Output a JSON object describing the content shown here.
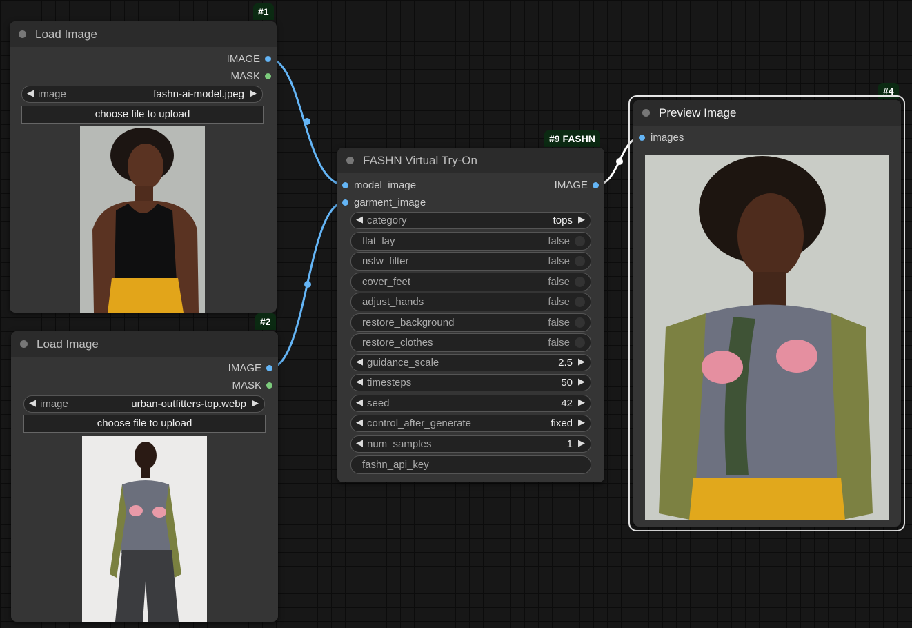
{
  "load1": {
    "badge": "#1",
    "title": "Load Image",
    "out_image": "IMAGE",
    "out_mask": "MASK",
    "combo_label": "image",
    "combo_value": "fashn-ai-model.jpeg",
    "upload_label": "choose file to upload"
  },
  "load2": {
    "badge": "#2",
    "title": "Load Image",
    "out_image": "IMAGE",
    "out_mask": "MASK",
    "combo_label": "image",
    "combo_value": "urban-outfitters-top.webp",
    "upload_label": "choose file to upload"
  },
  "fashn": {
    "badge": "#9 FASHN",
    "title": "FASHN Virtual Try-On",
    "in_model": "model_image",
    "in_garment": "garment_image",
    "out_image": "IMAGE",
    "widgets": [
      {
        "label": "category",
        "value": "tops",
        "kind": "combo"
      },
      {
        "label": "flat_lay",
        "value": "false",
        "kind": "toggle"
      },
      {
        "label": "nsfw_filter",
        "value": "false",
        "kind": "toggle"
      },
      {
        "label": "cover_feet",
        "value": "false",
        "kind": "toggle"
      },
      {
        "label": "adjust_hands",
        "value": "false",
        "kind": "toggle"
      },
      {
        "label": "restore_background",
        "value": "false",
        "kind": "toggle"
      },
      {
        "label": "restore_clothes",
        "value": "false",
        "kind": "toggle"
      },
      {
        "label": "guidance_scale",
        "value": "2.5",
        "kind": "number"
      },
      {
        "label": "timesteps",
        "value": "50",
        "kind": "number"
      },
      {
        "label": "seed",
        "value": "42",
        "kind": "number"
      },
      {
        "label": "control_after_generate",
        "value": "fixed",
        "kind": "combo"
      },
      {
        "label": "num_samples",
        "value": "1",
        "kind": "number"
      },
      {
        "label": "fashn_api_key",
        "value": "",
        "kind": "text"
      }
    ]
  },
  "preview": {
    "badge": "#4",
    "title": "Preview Image",
    "in_images": "images"
  },
  "colors": {
    "link_image": "#64b5f6",
    "link_selected": "#ffffff",
    "badge_bg": "#0b2a12"
  }
}
